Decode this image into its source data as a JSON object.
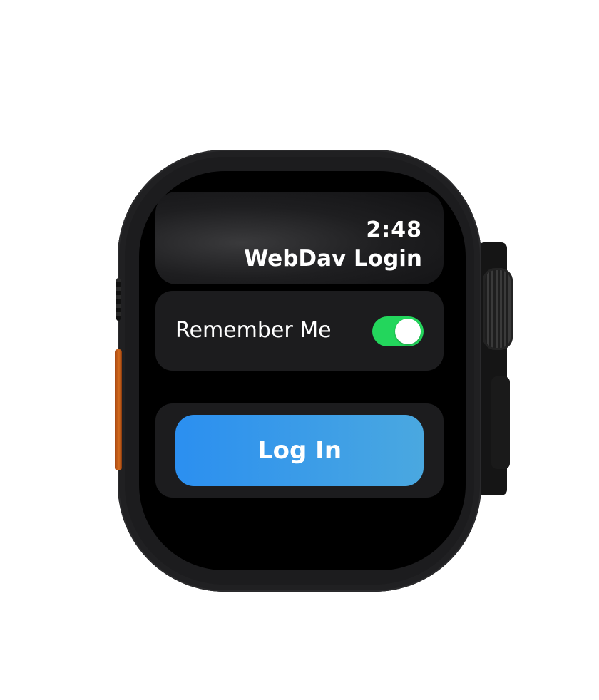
{
  "header": {
    "time": "2:48",
    "title": "WebDav Login"
  },
  "settings": {
    "remember_label": "Remember Me",
    "remember_on": true
  },
  "actions": {
    "login_label": "Log In"
  },
  "colors": {
    "toggle_on": "#23d65c",
    "button_start": "#2b8ff0",
    "button_end": "#4aa8e0",
    "action_button": "#d46a1e"
  }
}
